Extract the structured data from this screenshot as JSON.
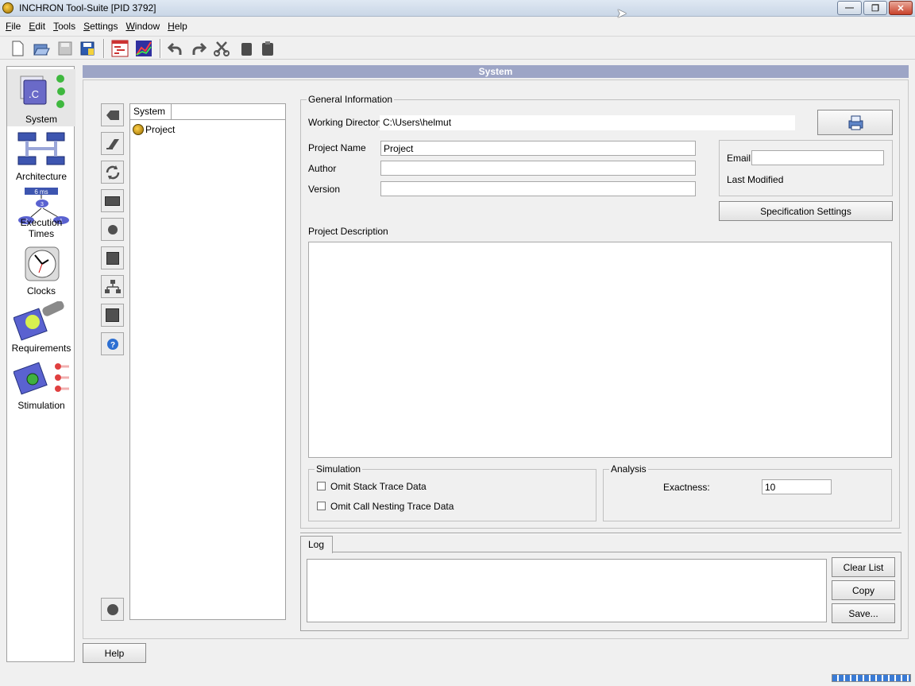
{
  "window": {
    "title": "INCHRON Tool-Suite [PID 3792]",
    "controls": {
      "minimize": "—",
      "restore": "❐",
      "close": "✕"
    }
  },
  "menu": [
    "File",
    "Edit",
    "Tools",
    "Settings",
    "Window",
    "Help"
  ],
  "toolbar_icons": [
    "new-icon",
    "open-icon",
    "save-icon",
    "save-as-icon",
    "gantt-icon",
    "chart-icon",
    "undo-icon",
    "redo-icon",
    "cut-icon",
    "copy-icon",
    "paste-icon"
  ],
  "nav": [
    {
      "label": "System",
      "icon": "system-icon",
      "active": true
    },
    {
      "label": "Architecture",
      "icon": "architecture-icon"
    },
    {
      "label": "Execution Times",
      "icon": "execution-times-icon"
    },
    {
      "label": "Clocks",
      "icon": "clock-icon"
    },
    {
      "label": "Requirements",
      "icon": "requirements-icon"
    },
    {
      "label": "Stimulation",
      "icon": "stimulation-icon"
    }
  ],
  "nav_graphics": {
    "exec_time_badge": "6 ms",
    "exec_nodes": [
      "3",
      "2",
      "1"
    ]
  },
  "section_header": "System",
  "tree": {
    "column": "System",
    "root": "Project"
  },
  "general": {
    "title": "General Information",
    "working_dir_label": "Working Directory",
    "working_dir_value": "C:\\Users\\helmut",
    "project_name_label": "Project Name",
    "project_name_value": "Project",
    "author_label": "Author",
    "author_value": "",
    "version_label": "Version",
    "version_value": "",
    "email_label": "Email",
    "email_value": "",
    "last_modified_label": "Last Modified",
    "spec_settings_button": "Specification Settings",
    "description_label": "Project Description",
    "description_value": ""
  },
  "simulation": {
    "title": "Simulation",
    "omit_stack": "Omit Stack Trace Data",
    "omit_call": "Omit Call Nesting Trace Data"
  },
  "analysis": {
    "title": "Analysis",
    "exactness_label": "Exactness:",
    "exactness_value": "10"
  },
  "log": {
    "tab": "Log",
    "clear_button": "Clear List",
    "copy_button": "Copy",
    "save_button": "Save..."
  },
  "help_button": "Help",
  "colors": {
    "header_bar": "#9da5c6",
    "progress": "#3a7bd5"
  }
}
